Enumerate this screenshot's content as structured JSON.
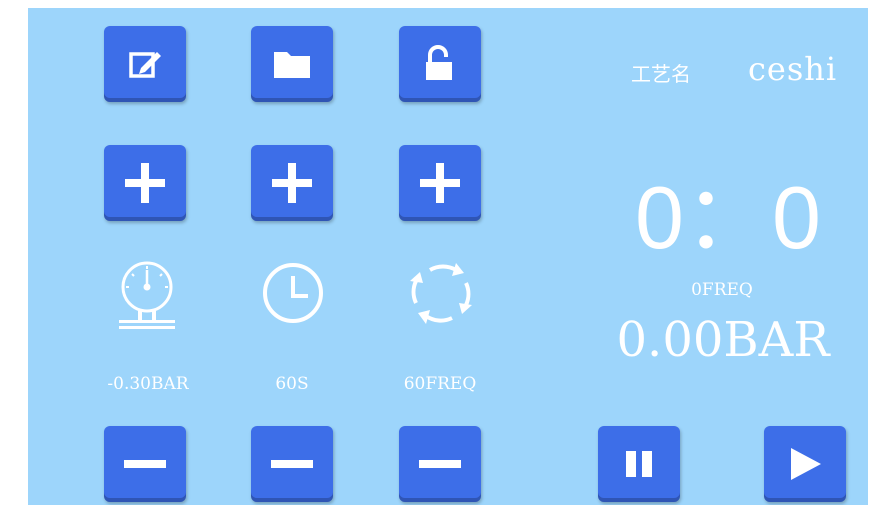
{
  "header": {
    "process_name_label": "工艺名",
    "process_name_value": "ceshi"
  },
  "controls": {
    "edit_icon": "edit-icon",
    "folder_icon": "folder-icon",
    "lock_icon": "unlock-icon",
    "plus_icon": "plus-icon",
    "minus_icon": "minus-icon"
  },
  "settings": {
    "pressure": "-0.30BAR",
    "time": "60S",
    "frequency": "60FREQ"
  },
  "status": {
    "timer": "0：0",
    "frequency": "0FREQ",
    "pressure": "0.00BAR"
  },
  "playback": {
    "pause_icon": "pause-icon",
    "play_icon": "play-icon"
  },
  "colors": {
    "background": "#9dd5fb",
    "button": "#3d6ee8",
    "text": "#ffffff"
  }
}
